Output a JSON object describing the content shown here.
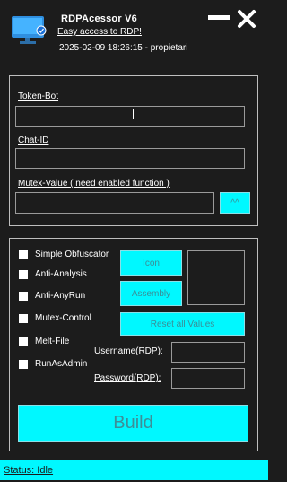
{
  "header": {
    "title": "RDPAcessor V6",
    "subtitle": "Easy access to RDP!",
    "datetime": "2025-02-09 18:26:15 - propietari",
    "icons": {
      "logo": "monitor-icon",
      "minimize": "minimize-icon",
      "close": "close-icon"
    }
  },
  "config": {
    "token_label": "Token-Bot",
    "token_value": "",
    "chat_label": "Chat-ID",
    "chat_value": "",
    "mutex_label": "Mutex-Value ( need enabled function )",
    "mutex_value": "",
    "mutex_button": "^^"
  },
  "options": {
    "checkboxes": [
      {
        "label": "Simple Obfuscator",
        "checked": false
      },
      {
        "label": "Anti-Analysis",
        "checked": false
      },
      {
        "label": "Anti-AnyRun",
        "checked": false
      },
      {
        "label": "Mutex-Control",
        "checked": false
      },
      {
        "label": "Melt-File",
        "checked": false
      },
      {
        "label": "RunAsAdmin",
        "checked": false
      }
    ],
    "icon_button": "Icon",
    "assembly_button": "Assembly",
    "reset_button": "Reset all Values",
    "username_label": "Username(RDP):",
    "username_value": "",
    "password_label": "Password(RDP):",
    "password_value": ""
  },
  "build_button": "Build",
  "status": "Status: Idle",
  "colors": {
    "accent": "#00f8ff",
    "background": "#1c1c1c",
    "button_text": "#3b8d96"
  }
}
